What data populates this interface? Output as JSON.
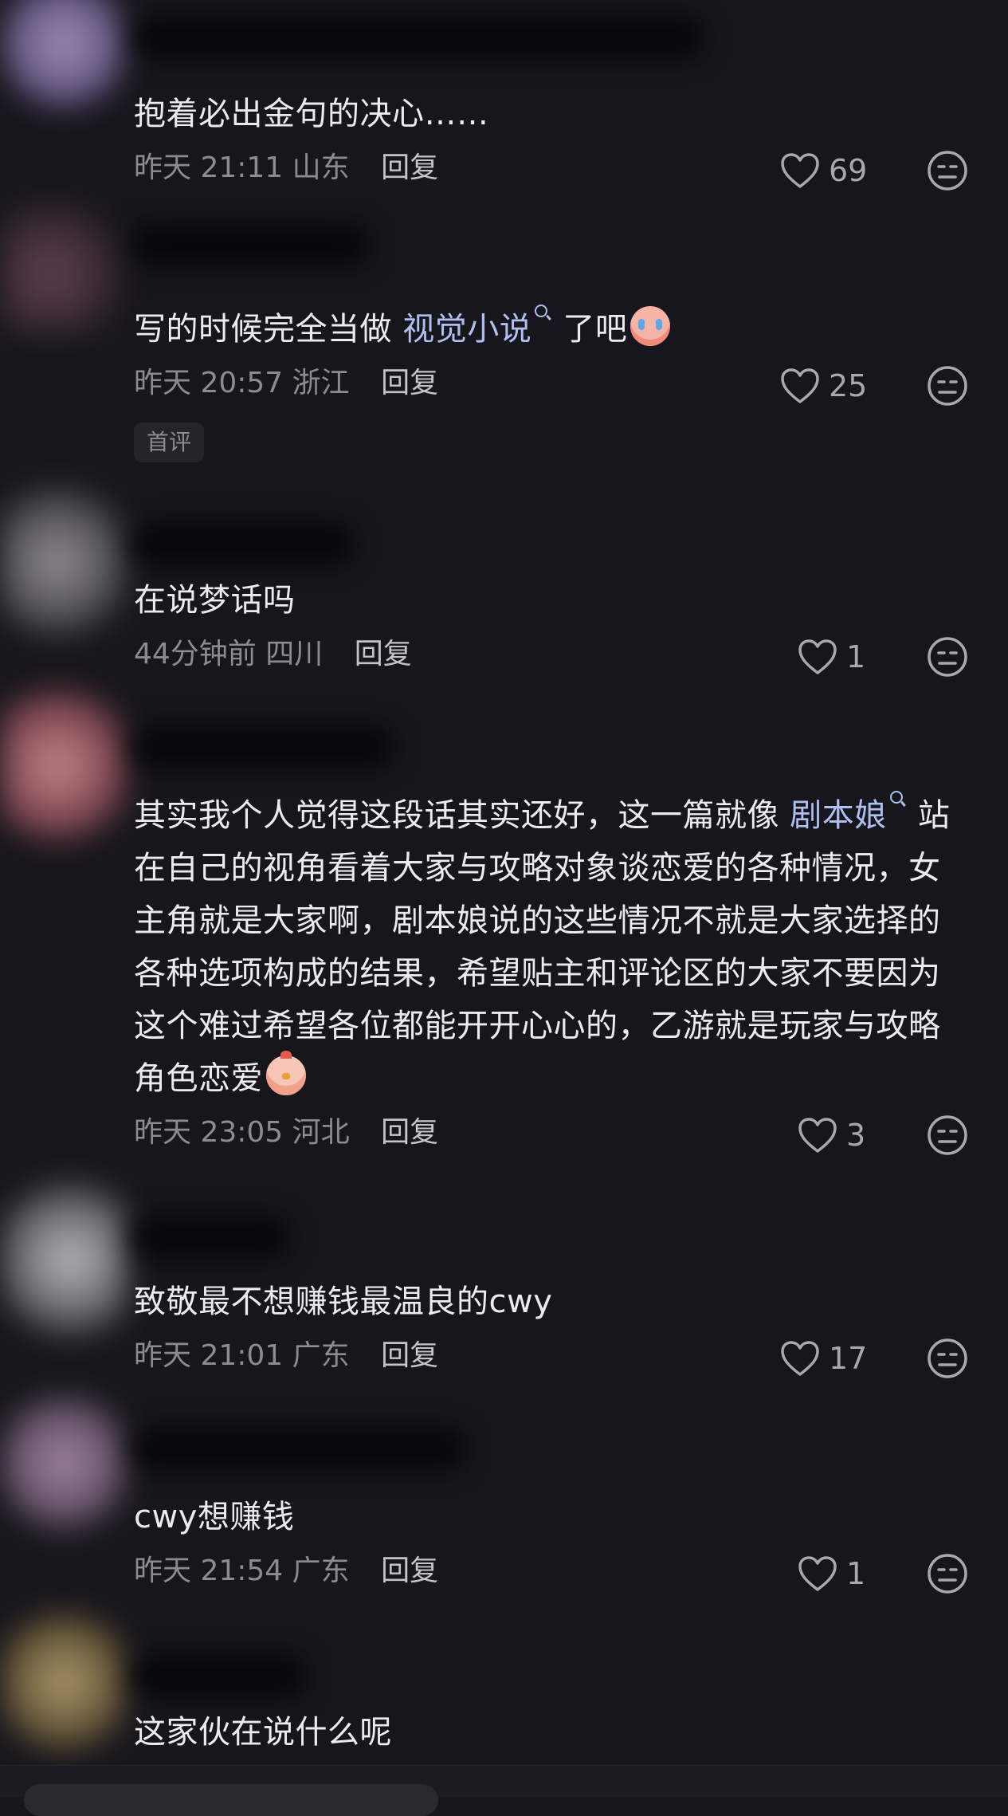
{
  "comments": [
    {
      "text": "抱着必出金句的决心……",
      "time": "昨天 21:11",
      "location": "山东",
      "reply_label": "回复",
      "likes": "69"
    },
    {
      "text_before": "写的时候完全当做 ",
      "link": "视觉小说",
      "text_after": " 了吧",
      "time": "昨天 20:57",
      "location": "浙江",
      "reply_label": "回复",
      "likes": "25",
      "tag": "首评"
    },
    {
      "text": "在说梦话吗",
      "time": "44分钟前",
      "location": "四川",
      "reply_label": "回复",
      "likes": "1"
    },
    {
      "text_before": "其实我个人觉得这段话其实还好，这一篇就像 ",
      "link": "剧本娘",
      "text_after": " 站在自己的视角看着大家与攻略对象谈恋爱的各种情况，女主角就是大家啊，剧本娘说的这些情况不就是大家选择的各种选项构成的结果，希望贴主和评论区的大家不要因为这个难过希望各位都能开开心心的，乙游就是玩家与攻略角色恋爱",
      "time": "昨天 23:05",
      "location": "河北",
      "reply_label": "回复",
      "likes": "3"
    },
    {
      "text": "致敬最不想赚钱最温良的cwy",
      "time": "昨天 21:01",
      "location": "广东",
      "reply_label": "回复",
      "likes": "17"
    },
    {
      "text": "cwy想赚钱",
      "time": "昨天 21:54",
      "location": "广东",
      "reply_label": "回复",
      "likes": "1"
    },
    {
      "text": "这家伙在说什么呢"
    }
  ],
  "icons": {
    "like": "heart-outline-icon",
    "dislike": "meh-face-icon",
    "link_search": "search-icon"
  },
  "colors": {
    "background": "#17161c",
    "link": "#aebff0",
    "meta": "#8c8b92"
  }
}
